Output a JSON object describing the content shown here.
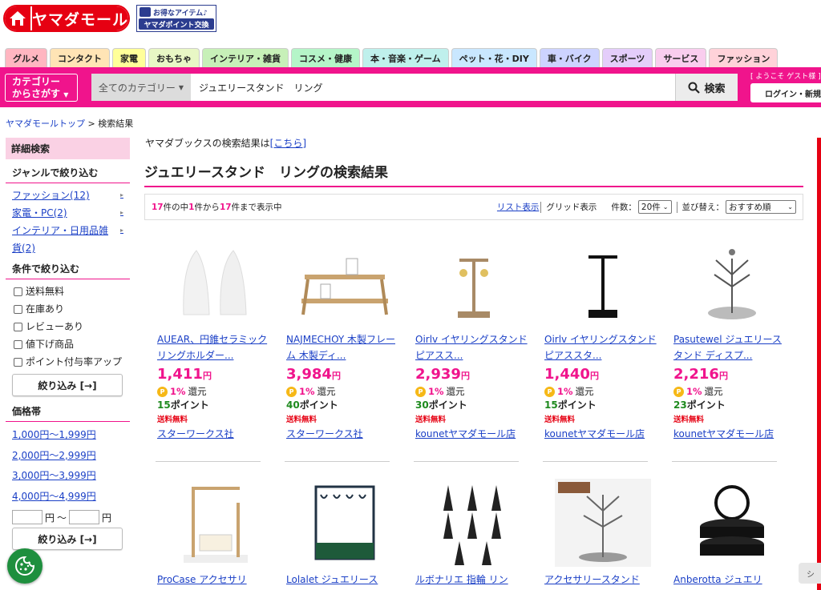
{
  "brand": {
    "logo_text": "ヤマダモール",
    "banner_title": "お得なアイテム♪",
    "banner_sub": "ヤマダポイント交換"
  },
  "tabs": [
    {
      "label": "グルメ",
      "color": "#ffb6c1"
    },
    {
      "label": "コンタクト",
      "color": "#ffe4b5"
    },
    {
      "label": "家電",
      "color": "#ffff99"
    },
    {
      "label": "おもちゃ",
      "color": "#e8f7c5"
    },
    {
      "label": "インテリア・雑貨",
      "color": "#c7f0b8"
    },
    {
      "label": "コスメ・健康",
      "color": "#b5f5c8"
    },
    {
      "label": "本・音楽・ゲーム",
      "color": "#bff0ec"
    },
    {
      "label": "ペット・花・DIY",
      "color": "#c9e7ff"
    },
    {
      "label": "車・バイク",
      "color": "#cdd3ff"
    },
    {
      "label": "スポーツ",
      "color": "#e4cdfa"
    },
    {
      "label": "サービス",
      "color": "#f9cdee"
    },
    {
      "label": "ファッション",
      "color": "#ffd2d9"
    }
  ],
  "search": {
    "category_button": [
      "カテゴリー",
      "からさがす"
    ],
    "category_select": "全てのカテゴリー",
    "query": "ジュエリースタンド　リング",
    "button": "検索",
    "welcome": "[ ようこそ ゲスト様 ]",
    "login": "ログイン・新規"
  },
  "breadcrumb": {
    "home": "ヤマダモールトップ",
    "sep": ">",
    "current": "検索結果"
  },
  "sidebar": {
    "heading": "詳細検索",
    "genre_title": "ジャンルで絞り込む",
    "genres": [
      {
        "label": "ファッション(12)"
      },
      {
        "label": "家電・PC(2)"
      },
      {
        "label": "インテリア・日用品雑貨(2)"
      }
    ],
    "condition_title": "条件で絞り込む",
    "conditions": [
      "送料無料",
      "在庫あり",
      "レビューあり",
      "値下げ商品",
      "ポイント付与率アップ"
    ],
    "filter_button": "絞り込み [→]",
    "price_title": "価格帯",
    "price_ranges": [
      "1,000円〜1,999円",
      "2,000円〜2,999円",
      "3,000円〜3,999円",
      "4,000円〜4,999円"
    ],
    "price_unit": "円",
    "price_tilde": "〜"
  },
  "main": {
    "books_text": "ヤマダブックスの検索結果は",
    "books_link": "[こちら]",
    "title": "ジュエリースタンド　リングの検索結果",
    "count": {
      "total": "17",
      "t1": " 件の中",
      "from": "1",
      "t2": "件から",
      "to": "17",
      "t3": "件まで表示中"
    },
    "list_view": "リスト表示",
    "grid_view": "グリッド表示",
    "per_page_label": "件数：",
    "per_page": "20件",
    "sort_label": "並び替え：",
    "sort": "おすすめ順"
  },
  "products": [
    {
      "name": "AUEAR、円錐セラミックリングホルダー...",
      "price": "1,411",
      "yen": "円",
      "rate": "1%",
      "rate_suffix": "還元",
      "points": "15",
      "points_suffix": "ポイント",
      "shipping": "送料無料",
      "shop": "スターワークス社"
    },
    {
      "name": "NAJMECHOY 木製フレーム 木製ディ...",
      "price": "3,984",
      "yen": "円",
      "rate": "1%",
      "rate_suffix": "還元",
      "points": "40",
      "points_suffix": "ポイント",
      "shipping": "送料無料",
      "shop": "スターワークス社"
    },
    {
      "name": "Oirlv イヤリングスタンド ピアスス...",
      "price": "2,939",
      "yen": "円",
      "rate": "1%",
      "rate_suffix": "還元",
      "points": "30",
      "points_suffix": "ポイント",
      "shipping": "送料無料",
      "shop": "kounetヤマダモール店"
    },
    {
      "name": "Oirlv イヤリングスタンド ピアススタ...",
      "price": "1,440",
      "yen": "円",
      "rate": "1%",
      "rate_suffix": "還元",
      "points": "15",
      "points_suffix": "ポイント",
      "shipping": "送料無料",
      "shop": "kounetヤマダモール店"
    },
    {
      "name": "Pasutewel ジュエリースタンド ディスプ...",
      "price": "2,216",
      "yen": "円",
      "rate": "1%",
      "rate_suffix": "還元",
      "points": "23",
      "points_suffix": "ポイント",
      "shipping": "送料無料",
      "shop": "kounetヤマダモール店"
    },
    {
      "name": "ProCase アクセサリ"
    },
    {
      "name": "Lolalet ジュエリース"
    },
    {
      "name": "ルボナリエ 指輪 リン"
    },
    {
      "name": "アクセサリースタンド"
    },
    {
      "name": "Anberotta ジュエリ"
    }
  ],
  "widgets": {
    "side_tab": "シ"
  }
}
